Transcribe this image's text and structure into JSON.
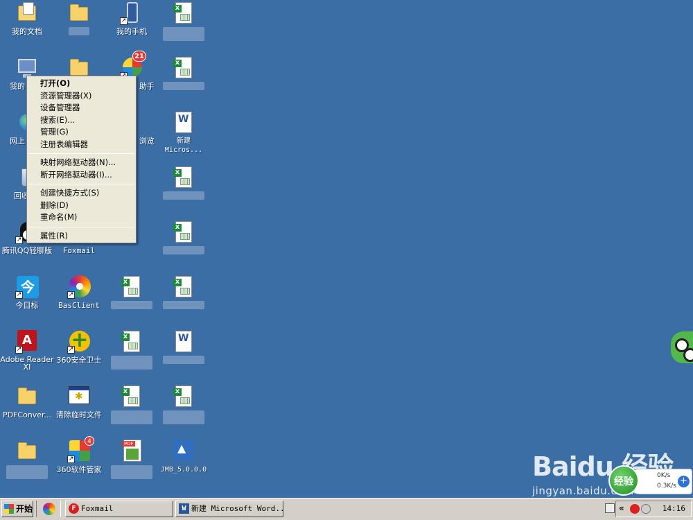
{
  "desktop": {
    "icons": {
      "my_documents": "我的文档",
      "my_phone": "我的手机",
      "my_computer_partial": "我的",
      "helper_partial": "助手",
      "helper_badge": "21",
      "network_partial": "网上",
      "browser_partial": "浏览",
      "new_word": "新建\nMicros...",
      "recycle_partial": "回收",
      "qq": "腾讯QQ轻聊版",
      "foxmail": "Foxmail",
      "jinritoutiao": "今目标",
      "basclient": "BasClient",
      "adobe": "Adobe Reader\nXI",
      "s360": "360安全卫士",
      "pdfconvert": "PDFConver...",
      "cleaner": "清除临时文件",
      "soft360": "360软件管家",
      "soft360_badge": "4",
      "jmb": "JMB_5.0.0.0",
      "jin_glyph": "今",
      "adobe_glyph": "A"
    }
  },
  "context_menu": {
    "items": [
      "打开(O)",
      "资源管理器(X)",
      "设备管理器",
      "搜索(E)...",
      "管理(G)",
      "注册表编辑器",
      "映射网络驱动器(N)...",
      "断开网络驱动器(I)...",
      "创建快捷方式(S)",
      "删除(D)",
      "重命名(M)",
      "属性(R)"
    ]
  },
  "speed_widget": {
    "ball_text": "经验",
    "up": "0K/s",
    "down": "0.3K/s",
    "plus": "+"
  },
  "watermark": {
    "brand": "Baidu 经验",
    "url": "jingyan.baidu.com"
  },
  "taskbar": {
    "start_label": "开始",
    "tasks": [
      {
        "label": "Foxmail",
        "icon_glyph": "F"
      },
      {
        "label": "新建 Microsoft Word...",
        "icon_glyph": "W"
      }
    ],
    "tray_chevron": "«",
    "clock": "14:16"
  }
}
